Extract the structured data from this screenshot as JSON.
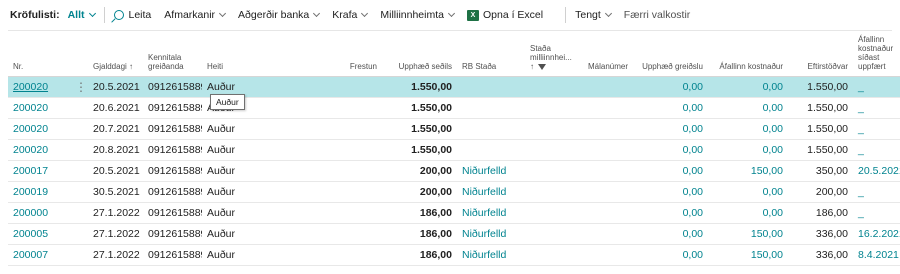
{
  "toolbar": {
    "caption": "Kröfulisti:",
    "view": "Allt",
    "search": "Leita",
    "items": [
      "Afmarkanir",
      "Aðgerðir banka",
      "Krafa",
      "Milliinnheimta"
    ],
    "excel": "Opna í Excel",
    "related": "Tengt",
    "fewer": "Færri valkostir"
  },
  "columns": {
    "nr": "Nr.",
    "due": "Gjalddagi",
    "due_sort": "↑",
    "payer_ssn": "Kennitala greiðanda",
    "name": "Heiti",
    "delay": "Frestun",
    "amount": "Upphæð seðils",
    "rb": "RB Staða",
    "coll_status": "Staða milliinnhei...",
    "coll_sort": "↑",
    "case_no": "Málanúmer",
    "paid": "Upphæð greiðslu",
    "cost": "Áfallinn kostnaður",
    "remaining": "Eftirstöðvar",
    "cost_updated": "Áfallinn kostnaður síðast uppfært"
  },
  "rows": [
    {
      "nr": "200020",
      "due": "20.5.2021",
      "ssn": "0912615889",
      "name": "Auður",
      "delay": "",
      "amount": "1.550,00",
      "rb": "",
      "coll": "",
      "case": "",
      "paid": "0,00",
      "cost": "0,00",
      "remaining": "1.550,00",
      "updated": "_"
    },
    {
      "nr": "200020",
      "due": "20.6.2021",
      "ssn": "0912615889",
      "name": "Auður",
      "delay": "",
      "amount": "1.550,00",
      "rb": "",
      "coll": "",
      "case": "",
      "paid": "0,00",
      "cost": "0,00",
      "remaining": "1.550,00",
      "updated": "_"
    },
    {
      "nr": "200020",
      "due": "20.7.2021",
      "ssn": "0912615889",
      "name": "Auður",
      "delay": "",
      "amount": "1.550,00",
      "rb": "",
      "coll": "",
      "case": "",
      "paid": "0,00",
      "cost": "0,00",
      "remaining": "1.550,00",
      "updated": "_"
    },
    {
      "nr": "200020",
      "due": "20.8.2021",
      "ssn": "0912615889",
      "name": "Auður",
      "delay": "",
      "amount": "1.550,00",
      "rb": "",
      "coll": "",
      "case": "",
      "paid": "0,00",
      "cost": "0,00",
      "remaining": "1.550,00",
      "updated": "_"
    },
    {
      "nr": "200017",
      "due": "20.5.2021",
      "ssn": "0912615889",
      "name": "Auður",
      "delay": "",
      "amount": "200,00",
      "rb": "Niðurfelld",
      "coll": "",
      "case": "",
      "paid": "0,00",
      "cost": "150,00",
      "remaining": "350,00",
      "updated": "20.5.2021"
    },
    {
      "nr": "200019",
      "due": "30.5.2021",
      "ssn": "0912615889",
      "name": "Auður",
      "delay": "",
      "amount": "200,00",
      "rb": "Niðurfelld",
      "coll": "",
      "case": "",
      "paid": "0,00",
      "cost": "0,00",
      "remaining": "200,00",
      "updated": "_"
    },
    {
      "nr": "200000",
      "due": "27.1.2022",
      "ssn": "0912615889",
      "name": "Auður",
      "delay": "",
      "amount": "186,00",
      "rb": "Niðurfelld",
      "coll": "",
      "case": "",
      "paid": "0,00",
      "cost": "0,00",
      "remaining": "186,00",
      "updated": "_"
    },
    {
      "nr": "200005",
      "due": "27.1.2022",
      "ssn": "0912615889",
      "name": "Auður",
      "delay": "",
      "amount": "186,00",
      "rb": "Niðurfelld",
      "coll": "",
      "case": "",
      "paid": "0,00",
      "cost": "150,00",
      "remaining": "336,00",
      "updated": "16.2.2021"
    },
    {
      "nr": "200007",
      "due": "27.1.2022",
      "ssn": "0912615889",
      "name": "Auður",
      "delay": "",
      "amount": "186,00",
      "rb": "Niðurfelld",
      "coll": "",
      "case": "",
      "paid": "0,00",
      "cost": "150,00",
      "remaining": "336,00",
      "updated": "8.4.2021"
    }
  ],
  "tooltip": "Auður",
  "colors": {
    "accent": "#00838f",
    "selected_row": "#b6e5e8"
  }
}
